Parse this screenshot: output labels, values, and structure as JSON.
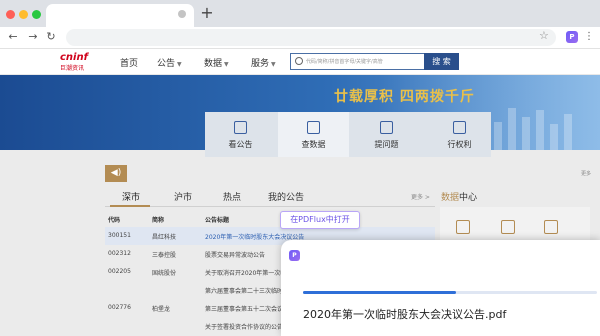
{
  "browser": {
    "ext_label": "P"
  },
  "site": {
    "logo": "cninf",
    "logo_sub": "巨潮资讯",
    "nav": [
      {
        "label": "首页"
      },
      {
        "label": "公告"
      },
      {
        "label": "数据"
      },
      {
        "label": "服务"
      }
    ],
    "search": {
      "placeholder": "代码/简称/拼音首字母/关键字/高管",
      "button": "搜 索"
    },
    "banner_slogan": "廿载厚积 四两拨千斤"
  },
  "services": [
    {
      "label": "看公告",
      "icon": "document-icon"
    },
    {
      "label": "查数据",
      "icon": "chart-line-icon"
    },
    {
      "label": "提问题",
      "icon": "chat-icon"
    },
    {
      "label": "行权利",
      "icon": "check-chart-icon"
    }
  ],
  "announcement": {
    "more_top": "更多",
    "tabs": [
      {
        "label": "深市"
      },
      {
        "label": "沪市"
      },
      {
        "label": "热点"
      },
      {
        "label": "我的公告"
      }
    ],
    "more": "更多 >",
    "columns": {
      "code": "代码",
      "name": "简称",
      "title": "公告标题"
    },
    "rows": [
      {
        "code": "300151",
        "name": "昌红科技",
        "title": "2020年第一次临时股东大会决议公告"
      },
      {
        "code": "002312",
        "name": "三泰控股",
        "title": "股票交易异常波动公告"
      },
      {
        "code": "002205",
        "name": "国统股份",
        "title": "关于取消召开2020年第一次临时股东大会的公告"
      },
      {
        "code": "",
        "name": "",
        "title": "第六届董事会第二十三次临时会议决议公告"
      },
      {
        "code": "002776",
        "name": "柏堡龙",
        "title": "第三届董事会第五十二次会议决议公告"
      },
      {
        "code": "",
        "name": "",
        "title": "关于签署投资合作协议的公告"
      }
    ]
  },
  "data_center": {
    "title_a": "数据",
    "title_b": "中心"
  },
  "pdflux": {
    "tooltip": "在PDFlux中打开",
    "popup_logo": "P",
    "filename": "2020年第一次临时股东大会决议公告.pdf",
    "progress": 0.52
  }
}
